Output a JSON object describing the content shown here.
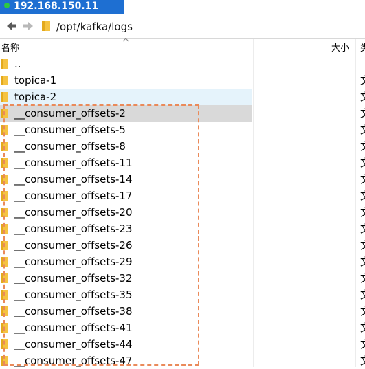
{
  "tab": {
    "title": "192.168.150.11"
  },
  "address_bar": {
    "path": "/opt/kafka/logs"
  },
  "columns": {
    "name": "名称",
    "size": "大小",
    "type": "类"
  },
  "rows": [
    {
      "name": "..",
      "type": ""
    },
    {
      "name": "topica-1",
      "type": "文"
    },
    {
      "name": "topica-2",
      "type": "文"
    },
    {
      "name": "__consumer_offsets-2",
      "type": "文"
    },
    {
      "name": "__consumer_offsets-5",
      "type": "文"
    },
    {
      "name": "__consumer_offsets-8",
      "type": "文"
    },
    {
      "name": "__consumer_offsets-11",
      "type": "文"
    },
    {
      "name": "__consumer_offsets-14",
      "type": "文"
    },
    {
      "name": "__consumer_offsets-17",
      "type": "文"
    },
    {
      "name": "__consumer_offsets-20",
      "type": "文"
    },
    {
      "name": "__consumer_offsets-23",
      "type": "文"
    },
    {
      "name": "__consumer_offsets-26",
      "type": "文"
    },
    {
      "name": "__consumer_offsets-29",
      "type": "文"
    },
    {
      "name": "__consumer_offsets-32",
      "type": "文"
    },
    {
      "name": "__consumer_offsets-35",
      "type": "文"
    },
    {
      "name": "__consumer_offsets-38",
      "type": "文"
    },
    {
      "name": "__consumer_offsets-41",
      "type": "文"
    },
    {
      "name": "__consumer_offsets-44",
      "type": "文"
    },
    {
      "name": "__consumer_offsets-47",
      "type": "文"
    }
  ],
  "colors": {
    "tab_bg": "#1e6fd2",
    "folder": "#f5c342",
    "hover_row": "#e5f3fb",
    "selected_row": "#d9d9d9",
    "annotation_box": "#ea8a5a"
  },
  "icons": {
    "back": "arrow-left-icon",
    "forward": "arrow-right-icon",
    "folder": "folder-icon",
    "sort": "chevron-up-icon"
  }
}
